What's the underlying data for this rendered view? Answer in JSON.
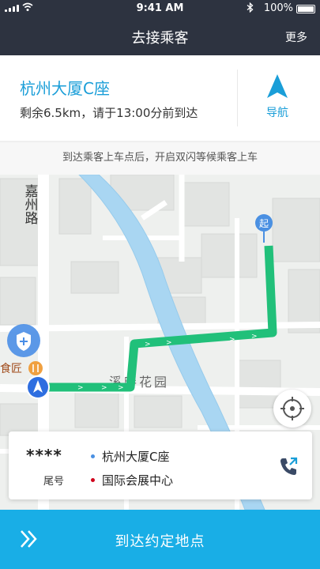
{
  "status_bar": {
    "time": "9:41 AM",
    "battery": "100%",
    "wifi_icon": "wifi-icon",
    "bluetooth_icon": "bluetooth-icon"
  },
  "nav": {
    "title": "去接乘客",
    "more": "更多"
  },
  "destination": {
    "name": "杭州大厦C座",
    "info": "剩余6.5km，请于13:00分前到达",
    "nav_button_label": "导航",
    "nav_icon": "navigation-arrow-icon",
    "accent_color": "#1a9ed8"
  },
  "tip": "到达乘客上车点后，开启双闪等候乘客上车",
  "map": {
    "street_label": "嘉州路",
    "park_label": "溪畔花园",
    "poi_label": "食匠",
    "start_marker": "起",
    "route_color": "#21c07a"
  },
  "passenger": {
    "masked_phone": "****",
    "tail_label": "尾号",
    "from": "杭州大厦C座",
    "to": "国际会展中心",
    "from_dot_color": "#4a90e2",
    "to_dot_color": "#d0021b"
  },
  "bottom": {
    "action_label": "到达约定地点"
  }
}
